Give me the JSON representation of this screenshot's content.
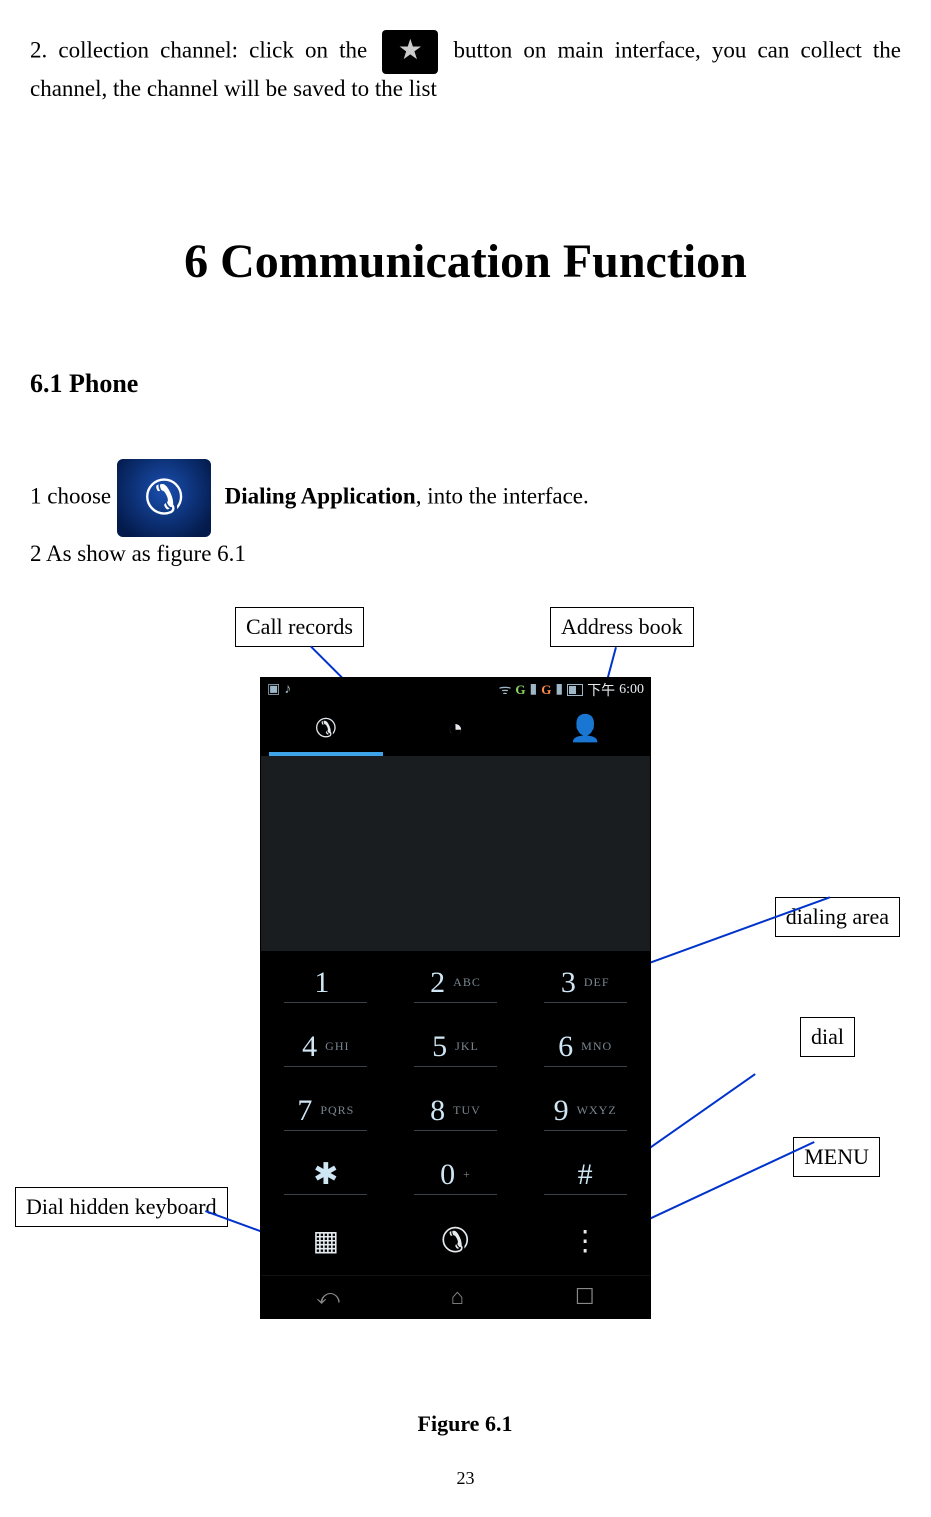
{
  "intro": {
    "prefix": "2. collection channel: click on the ",
    "suffix": " button on main interface, you can collect the channel, the channel will be saved to the list"
  },
  "chapter": "6   Communication Function",
  "section": "6.1 Phone",
  "step1_prefix": "1 choose ",
  "step1_app": "Dialing Application",
  "step1_suffix": ", into the interface.",
  "step2": "2   As show as figure 6.1",
  "callouts": {
    "call_records": "Call records",
    "address_book": "Address book",
    "dialing_area": "dialing area",
    "dial": "dial",
    "menu": "MENU",
    "hidden_kb": "Dial hidden keyboard"
  },
  "phone": {
    "status": {
      "clock_prefix": "下午",
      "clock": "6:00",
      "g1": "G",
      "g2": "G"
    },
    "tabs": {
      "phone": "phone-icon",
      "clock": "clock-icon",
      "person": "person-icon"
    },
    "keys": [
      [
        {
          "d": "1",
          "l": ""
        },
        {
          "d": "2",
          "l": "ABC"
        },
        {
          "d": "3",
          "l": "DEF"
        }
      ],
      [
        {
          "d": "4",
          "l": "GHI"
        },
        {
          "d": "5",
          "l": "JKL"
        },
        {
          "d": "6",
          "l": "MNO"
        }
      ],
      [
        {
          "d": "7",
          "l": "PQRS"
        },
        {
          "d": "8",
          "l": "TUV"
        },
        {
          "d": "9",
          "l": "WXYZ"
        }
      ],
      [
        {
          "d": "✱",
          "l": ""
        },
        {
          "d": "0",
          "l": "+"
        },
        {
          "d": "#",
          "l": ""
        }
      ]
    ]
  },
  "figure_caption": "Figure 6.1",
  "page_number": "23"
}
